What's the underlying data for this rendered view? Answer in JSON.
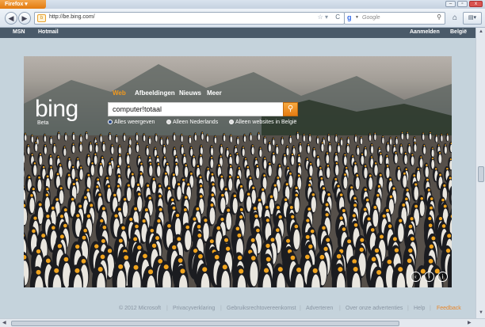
{
  "browser": {
    "app_button": "Firefox",
    "url": "http://be.bing.com/",
    "search_placeholder": "Google",
    "menu_label": "▤▾"
  },
  "topbar": {
    "left": [
      "MSN",
      "Hotmail"
    ],
    "right": [
      "Aanmelden",
      "België"
    ]
  },
  "bing": {
    "logo": "bing",
    "beta": "Beta",
    "tabs": [
      "Web",
      "Afbeeldingen",
      "Nieuws",
      "Meer"
    ],
    "query": "computer!totaal",
    "options": [
      "Alles weergeven",
      "Alleen Nederlands",
      "Alleen websites in België"
    ]
  },
  "footer": {
    "items": [
      "© 2012 Microsoft",
      "Privacyverklaring",
      "Gebruiksrechtovereenkomst",
      "Adverteren",
      "Over onze advertenties",
      "Help",
      "Feedback"
    ]
  },
  "colors": {
    "accent": "#f39a1e",
    "topbar": "#4a5a69"
  }
}
